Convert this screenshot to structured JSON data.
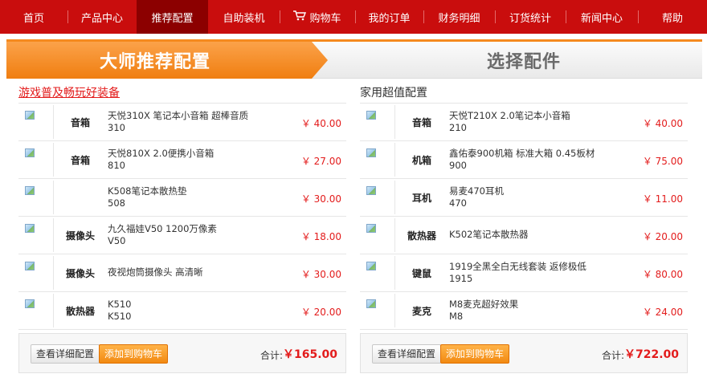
{
  "nav": {
    "items": [
      {
        "label": "首页",
        "active": false
      },
      {
        "label": "产品中心",
        "active": false
      },
      {
        "label": "推荐配置",
        "active": true
      },
      {
        "label": "自助装机",
        "active": false
      },
      {
        "label": "购物车",
        "active": false
      },
      {
        "label": "我的订单",
        "active": false
      },
      {
        "label": "财务明细",
        "active": false
      },
      {
        "label": "订货统计",
        "active": false
      },
      {
        "label": "新闻中心",
        "active": false
      },
      {
        "label": "帮助",
        "active": false
      }
    ]
  },
  "banner": {
    "tab_master": "大师推荐配置",
    "tab_select": "选择配件",
    "accent_color": "#f58a1f"
  },
  "left_panel": {
    "title": "游戏普及畅玩好装备",
    "rows": [
      {
        "category": "音箱",
        "name": "天悦310X 笔记本小音箱 超棒音质",
        "model": "310",
        "price": "￥ 40.00"
      },
      {
        "category": "音箱",
        "name": "天悦810X 2.0便携小音箱",
        "model": "810",
        "price": "￥ 27.00"
      },
      {
        "category": "",
        "name": "K508笔记本散热垫",
        "model": "508",
        "price": "￥ 30.00"
      },
      {
        "category": "摄像头",
        "name": "九久福娃V50 1200万像素",
        "model": "V50",
        "price": "￥ 18.00"
      },
      {
        "category": "摄像头",
        "name": "夜视炮筒摄像头 高清晰",
        "model": "",
        "price": "￥ 30.00"
      },
      {
        "category": "散热器",
        "name": "K510",
        "model": "K510",
        "price": "￥ 20.00"
      }
    ],
    "detail_button": "查看详细配置",
    "add_button": "添加到购物车",
    "total_label": "合计:",
    "total_value": "￥165.00"
  },
  "right_panel": {
    "title": "家用超值配置",
    "rows": [
      {
        "category": "音箱",
        "name": "天悦T210X 2.0笔记本小音箱",
        "model": "210",
        "price": "￥ 40.00"
      },
      {
        "category": "机箱",
        "name": "鑫佑泰900机箱 标准大箱 0.45板材",
        "model": "900",
        "price": "￥ 75.00"
      },
      {
        "category": "耳机",
        "name": "易麦470耳机",
        "model": "470",
        "price": "￥ 11.00"
      },
      {
        "category": "散热器",
        "name": "K502笔记本散热器",
        "model": "",
        "price": "￥ 20.00"
      },
      {
        "category": "键鼠",
        "name": "1919全黑全白无线套装 返修极低",
        "model": "1915",
        "price": "￥ 80.00"
      },
      {
        "category": "麦克",
        "name": "M8麦克超好效果",
        "model": "M8",
        "price": "￥ 24.00"
      }
    ],
    "detail_button": "查看详细配置",
    "add_button": "添加到购物车",
    "total_label": "合计:",
    "total_value": "￥722.00"
  }
}
